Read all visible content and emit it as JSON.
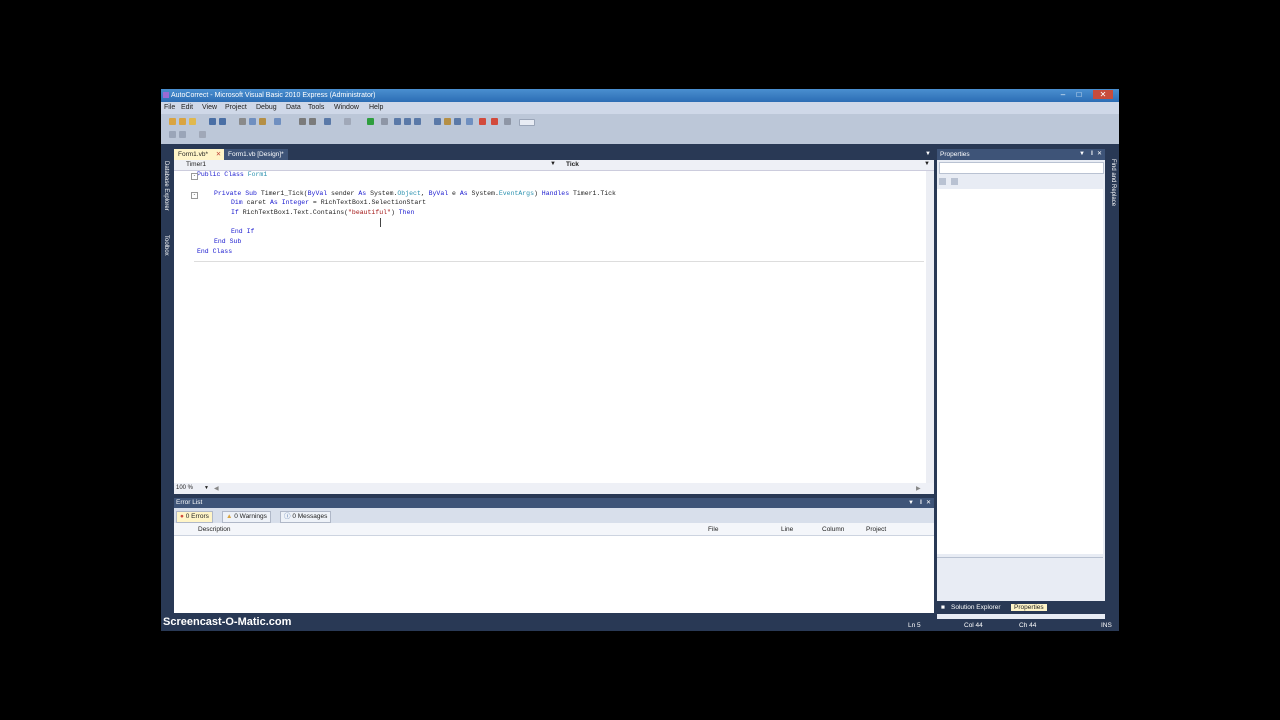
{
  "window": {
    "title": "AutoCorrect - Microsoft Visual Basic 2010 Express (Administrator)"
  },
  "menu": [
    "File",
    "Edit",
    "View",
    "Project",
    "Debug",
    "Data",
    "Tools",
    "Window",
    "Help"
  ],
  "tabs": [
    {
      "label": "Form1.vb*",
      "active": true
    },
    {
      "label": "Form1.vb [Design]*",
      "active": false
    }
  ],
  "left_panels": [
    "Database Explorer",
    "Toolbox"
  ],
  "right_panels": [
    "Find and Replace"
  ],
  "editor": {
    "object_dropdown": "Timer1",
    "event_dropdown": "Tick",
    "zoom": "100 %",
    "code_lines": [
      "Public Class Form1",
      "",
      "    Private Sub Timer1_Tick(ByVal sender As System.Object, ByVal e As System.EventArgs) Handles Timer1.Tick",
      "        Dim caret As Integer = RichTextBox1.SelectionStart",
      "        If RichTextBox1.Text.Contains(\"beautiful\") Then",
      "",
      "        End If",
      "    End Sub",
      "End Class"
    ]
  },
  "properties": {
    "title": "Properties"
  },
  "error_list": {
    "title": "Error List",
    "tabs": [
      "0 Errors",
      "0 Warnings",
      "0 Messages"
    ],
    "columns": [
      "Description",
      "File",
      "Line",
      "Column",
      "Project"
    ]
  },
  "bottom_tabs": [
    "Solution Explorer",
    "Properties"
  ],
  "status": {
    "ln": "Ln 5",
    "col": "Col 44",
    "ch": "Ch 44",
    "mode": "INS"
  },
  "watermark": "Screencast-O-Matic.com",
  "colors": {
    "accent": "#293955",
    "tab_active": "#fff5c8",
    "keyword": "#1a1acf",
    "type": "#2b91af",
    "string": "#a31515"
  }
}
